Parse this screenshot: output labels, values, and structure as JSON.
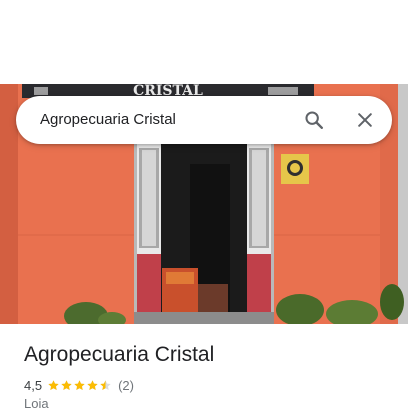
{
  "search": {
    "query": "Agropecuaria Cristal"
  },
  "photo": {
    "sign_text": "CRISTAL"
  },
  "place": {
    "name": "Agropecuaria Cristal",
    "rating": "4,5",
    "rating_value": 4.5,
    "stars_max": 5,
    "review_count": "(2)",
    "category": "Loja"
  },
  "icons": {
    "search": "search-icon",
    "close": "close-icon",
    "star": "star-icon"
  },
  "colors": {
    "star": "#fbbc04",
    "wall": "#e8704f",
    "text_primary": "#202124",
    "text_secondary": "#70757a"
  }
}
